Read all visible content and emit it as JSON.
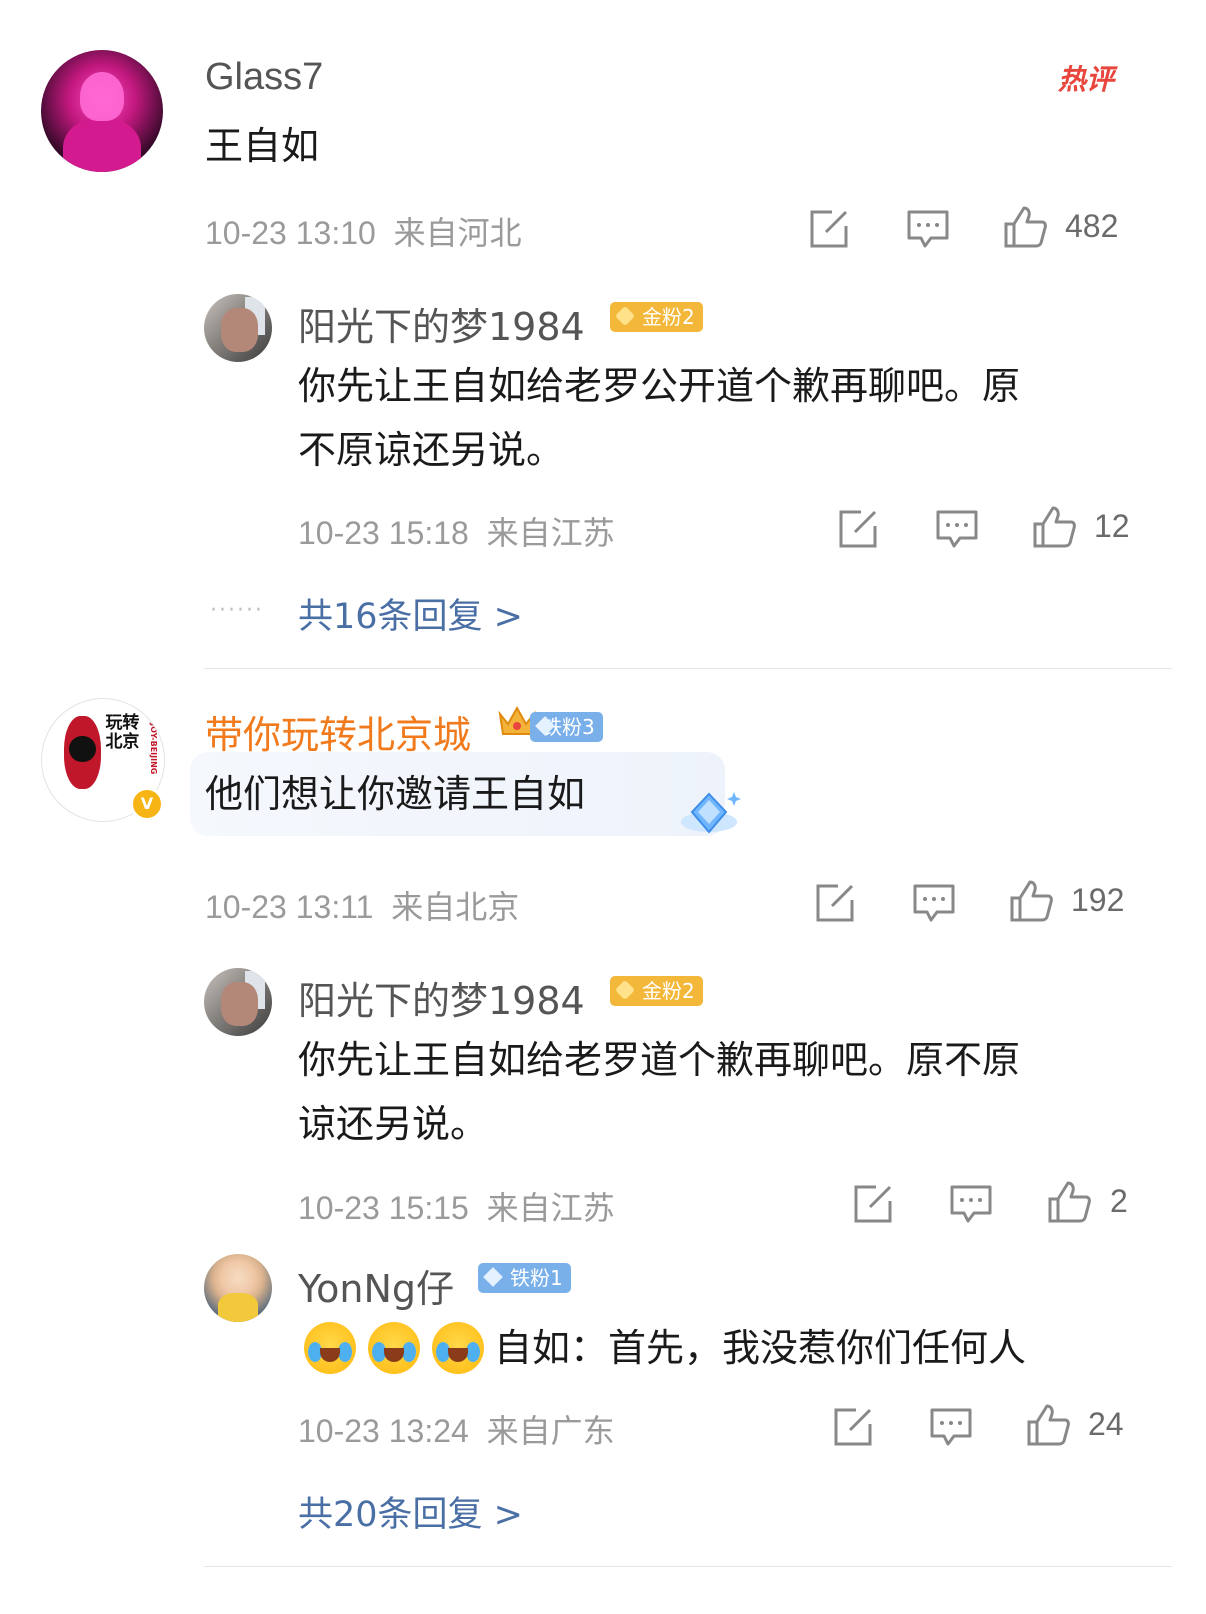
{
  "hot_label": "热评",
  "threads": [
    {
      "user": "Glass7",
      "text": "王自如",
      "time": "10-23 13:10",
      "location": "来自河北",
      "likes": "482",
      "reply": {
        "user": "阳光下的梦1984",
        "badge": "金粉2",
        "text_line1": "你先让王自如给老罗公开道个歉再聊吧。原",
        "text_line2": "不原谅还另说。",
        "time": "10-23 15:18",
        "location": "来自江苏",
        "likes": "12"
      },
      "more_dots": "······",
      "more_replies": "共16条回复 >"
    },
    {
      "user": "带你玩转北京城",
      "badge": "铁粉3",
      "avatar_text": "玩转北京",
      "avatar_side_text": "ENJOY-BEIJING",
      "text": "他们想让你邀请王自如",
      "time": "10-23 13:11",
      "location": "来自北京",
      "likes": "192",
      "replies": [
        {
          "user": "阳光下的梦1984",
          "badge": "金粉2",
          "text_line1": "你先让王自如给老罗道个歉再聊吧。原不原",
          "text_line2": "谅还另说。",
          "time": "10-23 15:15",
          "location": "来自江苏",
          "likes": "2"
        },
        {
          "user": "YonNg仔",
          "badge": "铁粉1",
          "emoji_count": 3,
          "emoji_name": "laugh-cry-emoji",
          "text": "自如：首先，我没惹你们任何人",
          "time": "10-23 13:24",
          "location": "来自广东",
          "likes": "24"
        }
      ],
      "more_replies": "共20条回复 >"
    }
  ]
}
